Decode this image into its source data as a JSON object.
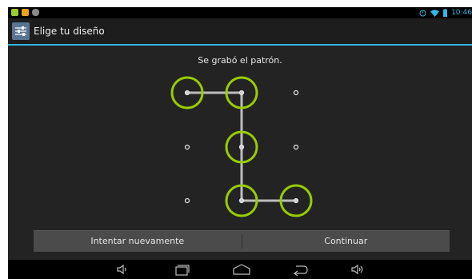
{
  "status_bar": {
    "time": "10:46",
    "left_icons": [
      "android-icon",
      "shopping-bag-icon",
      "notification-icon"
    ],
    "right_icons": [
      "alarm-icon",
      "wifi-icon",
      "battery-icon"
    ]
  },
  "action_bar": {
    "title": "Elige tu diseño",
    "icon": "settings-app-icon"
  },
  "pattern_screen": {
    "message": "Se grabó el patrón.",
    "dots": [
      {
        "row": 1,
        "col": 1,
        "selected": true
      },
      {
        "row": 1,
        "col": 2,
        "selected": true
      },
      {
        "row": 1,
        "col": 3,
        "selected": false
      },
      {
        "row": 2,
        "col": 1,
        "selected": false
      },
      {
        "row": 2,
        "col": 2,
        "selected": true
      },
      {
        "row": 2,
        "col": 3,
        "selected": false
      },
      {
        "row": 3,
        "col": 1,
        "selected": false
      },
      {
        "row": 3,
        "col": 2,
        "selected": true
      },
      {
        "row": 3,
        "col": 3,
        "selected": true
      }
    ],
    "path_order": [
      [
        1,
        1
      ],
      [
        1,
        2
      ],
      [
        2,
        2
      ],
      [
        3,
        2
      ],
      [
        3,
        3
      ]
    ],
    "selected_ring_color": "#99cc00",
    "path_color": "#bdbdbd"
  },
  "buttons": {
    "retry_label": "Intentar nuevamente",
    "continue_label": "Continuar"
  },
  "nav_bar": {
    "items": [
      "volume-down-icon",
      "recent-apps-icon",
      "home-icon",
      "back-icon",
      "volume-up-icon"
    ]
  },
  "colors": {
    "accent": "#33b5e5",
    "background": "#232323",
    "button_bar": "#4b4b4b"
  }
}
